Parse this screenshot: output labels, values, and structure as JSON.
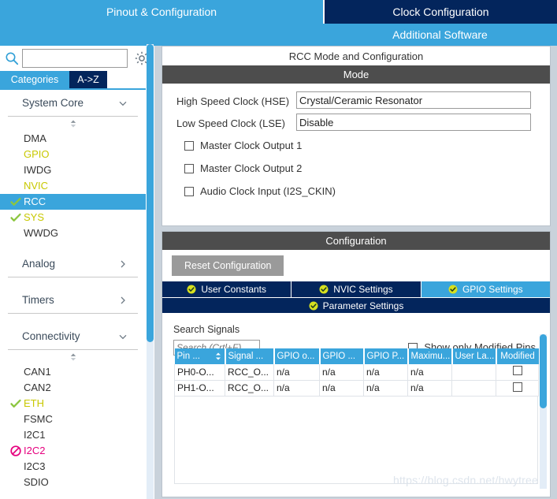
{
  "topbar": {
    "tabs": [
      {
        "label": "Pinout & Configuration",
        "active": true
      },
      {
        "label": "Clock Configuration",
        "active": false
      },
      {
        "label": "Additional Software",
        "active": false
      }
    ]
  },
  "sidebar": {
    "search": {
      "value": "",
      "placeholder": ""
    },
    "search_icon": "search-icon",
    "gear_icon": "gear-icon",
    "mode_tabs": [
      {
        "label": "Categories",
        "active": true
      },
      {
        "label": "A->Z",
        "active": false
      }
    ],
    "groups": [
      {
        "name": "System Core",
        "expanded": true,
        "items": [
          {
            "label": "DMA",
            "state": "none",
            "selected": false
          },
          {
            "label": "GPIO",
            "state": "partial",
            "selected": false
          },
          {
            "label": "IWDG",
            "state": "none",
            "selected": false
          },
          {
            "label": "NVIC",
            "state": "partial",
            "selected": false
          },
          {
            "label": "RCC",
            "state": "ok",
            "selected": true
          },
          {
            "label": "SYS",
            "state": "ok",
            "selected": false
          },
          {
            "label": "WWDG",
            "state": "none",
            "selected": false
          }
        ]
      },
      {
        "name": "Analog",
        "expanded": false,
        "items": []
      },
      {
        "name": "Timers",
        "expanded": false,
        "items": []
      },
      {
        "name": "Connectivity",
        "expanded": true,
        "items": [
          {
            "label": "CAN1",
            "state": "none",
            "selected": false
          },
          {
            "label": "CAN2",
            "state": "none",
            "selected": false
          },
          {
            "label": "ETH",
            "state": "ok",
            "selected": false
          },
          {
            "label": "FSMC",
            "state": "none",
            "selected": false
          },
          {
            "label": "I2C1",
            "state": "none",
            "selected": false
          },
          {
            "label": "I2C2",
            "state": "blocked",
            "selected": false
          },
          {
            "label": "I2C3",
            "state": "none",
            "selected": false
          },
          {
            "label": "SDIO",
            "state": "none",
            "selected": false
          }
        ]
      }
    ]
  },
  "main": {
    "title": "RCC Mode and Configuration",
    "mode": {
      "header": "Mode",
      "fields": [
        {
          "label": "High Speed Clock (HSE)",
          "value": "Crystal/Ceramic Resonator"
        },
        {
          "label": "Low Speed Clock (LSE)",
          "value": "Disable"
        }
      ],
      "checkboxes": [
        {
          "label": "Master Clock Output 1",
          "checked": false
        },
        {
          "label": "Master Clock Output 2",
          "checked": false
        },
        {
          "label": "Audio Clock Input (I2S_CKIN)",
          "checked": false
        }
      ]
    },
    "configuration": {
      "header": "Configuration",
      "reset_label": "Reset Configuration",
      "tabs_row1": [
        {
          "label": "User Constants",
          "active": false
        },
        {
          "label": "NVIC Settings",
          "active": false
        },
        {
          "label": "GPIO Settings",
          "active": true
        }
      ],
      "tabs_row2": [
        {
          "label": "Parameter Settings",
          "active": false
        }
      ],
      "search_signals_label": "Search Signals",
      "search_signals_placeholder": "Search (Crtl+F)",
      "search_signals_value": "",
      "show_modified_label": "Show only Modified Pins",
      "show_modified_checked": false,
      "table": {
        "columns": [
          "Pin ...",
          "Signal ...",
          "GPIO o...",
          "GPIO ...",
          "GPIO P...",
          "Maximu...",
          "User La...",
          "Modified"
        ],
        "sorted_column": 0,
        "rows": [
          {
            "pin": "PH0-O...",
            "signal": "RCC_O...",
            "gpio_output": "n/a",
            "gpio_mode": "n/a",
            "gpio_pull": "n/a",
            "maximum": "n/a",
            "user_label": "",
            "modified": false
          },
          {
            "pin": "PH1-O...",
            "signal": "RCC_O...",
            "gpio_output": "n/a",
            "gpio_mode": "n/a",
            "gpio_pull": "n/a",
            "maximum": "n/a",
            "user_label": "",
            "modified": false
          }
        ]
      }
    }
  },
  "watermark": "https://blog.csdn.net/hwytree",
  "colors": {
    "accent_blue": "#3aa5dc",
    "navy": "#03255c",
    "dark_bar": "#4d4d4d",
    "yellow": "#c8c800",
    "pink": "#e6007e",
    "green_check": "#8cc63f",
    "panel_bg": "#c9d2db"
  }
}
